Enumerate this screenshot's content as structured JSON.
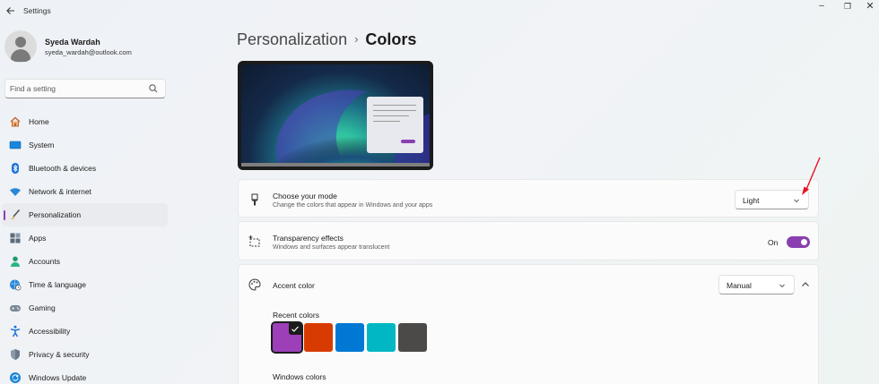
{
  "window": {
    "title": "Settings",
    "back_icon": "back-arrow-icon",
    "minimize_glyph": "–",
    "maximize_glyph": "❐",
    "close_glyph": "✕"
  },
  "profile": {
    "name": "Syeda Wardah",
    "email": "syeda_wardah@outlook.com"
  },
  "search": {
    "placeholder": "Find a setting"
  },
  "sidebar": {
    "items": [
      {
        "label": "Home",
        "icon": "home-icon"
      },
      {
        "label": "System",
        "icon": "monitor-icon"
      },
      {
        "label": "Bluetooth & devices",
        "icon": "bluetooth-icon"
      },
      {
        "label": "Network & internet",
        "icon": "wifi-icon"
      },
      {
        "label": "Personalization",
        "icon": "brush-icon",
        "selected": true
      },
      {
        "label": "Apps",
        "icon": "apps-icon"
      },
      {
        "label": "Accounts",
        "icon": "person-icon"
      },
      {
        "label": "Time & language",
        "icon": "globe-clock-icon"
      },
      {
        "label": "Gaming",
        "icon": "gamepad-icon"
      },
      {
        "label": "Accessibility",
        "icon": "accessibility-icon"
      },
      {
        "label": "Privacy & security",
        "icon": "shield-icon"
      },
      {
        "label": "Windows Update",
        "icon": "update-icon"
      }
    ]
  },
  "breadcrumb": {
    "parent": "Personalization",
    "separator": "›",
    "current": "Colors"
  },
  "mode": {
    "title": "Choose your mode",
    "description": "Change the colors that appear in Windows and your apps",
    "value": "Light"
  },
  "transparency": {
    "title": "Transparency effects",
    "description": "Windows and surfaces appear translucent",
    "state_label": "On",
    "on": true
  },
  "accent": {
    "title": "Accent color",
    "value": "Manual",
    "recent_label": "Recent colors",
    "recent_colors": [
      "#9c3fb8",
      "#d83b01",
      "#0078d4",
      "#00b7c3",
      "#4c4a48"
    ],
    "selected_index": 0,
    "windows_colors_label": "Windows colors"
  },
  "colors": {
    "accent": "#8a3fb1",
    "annotation_arrow": "#e81123"
  }
}
